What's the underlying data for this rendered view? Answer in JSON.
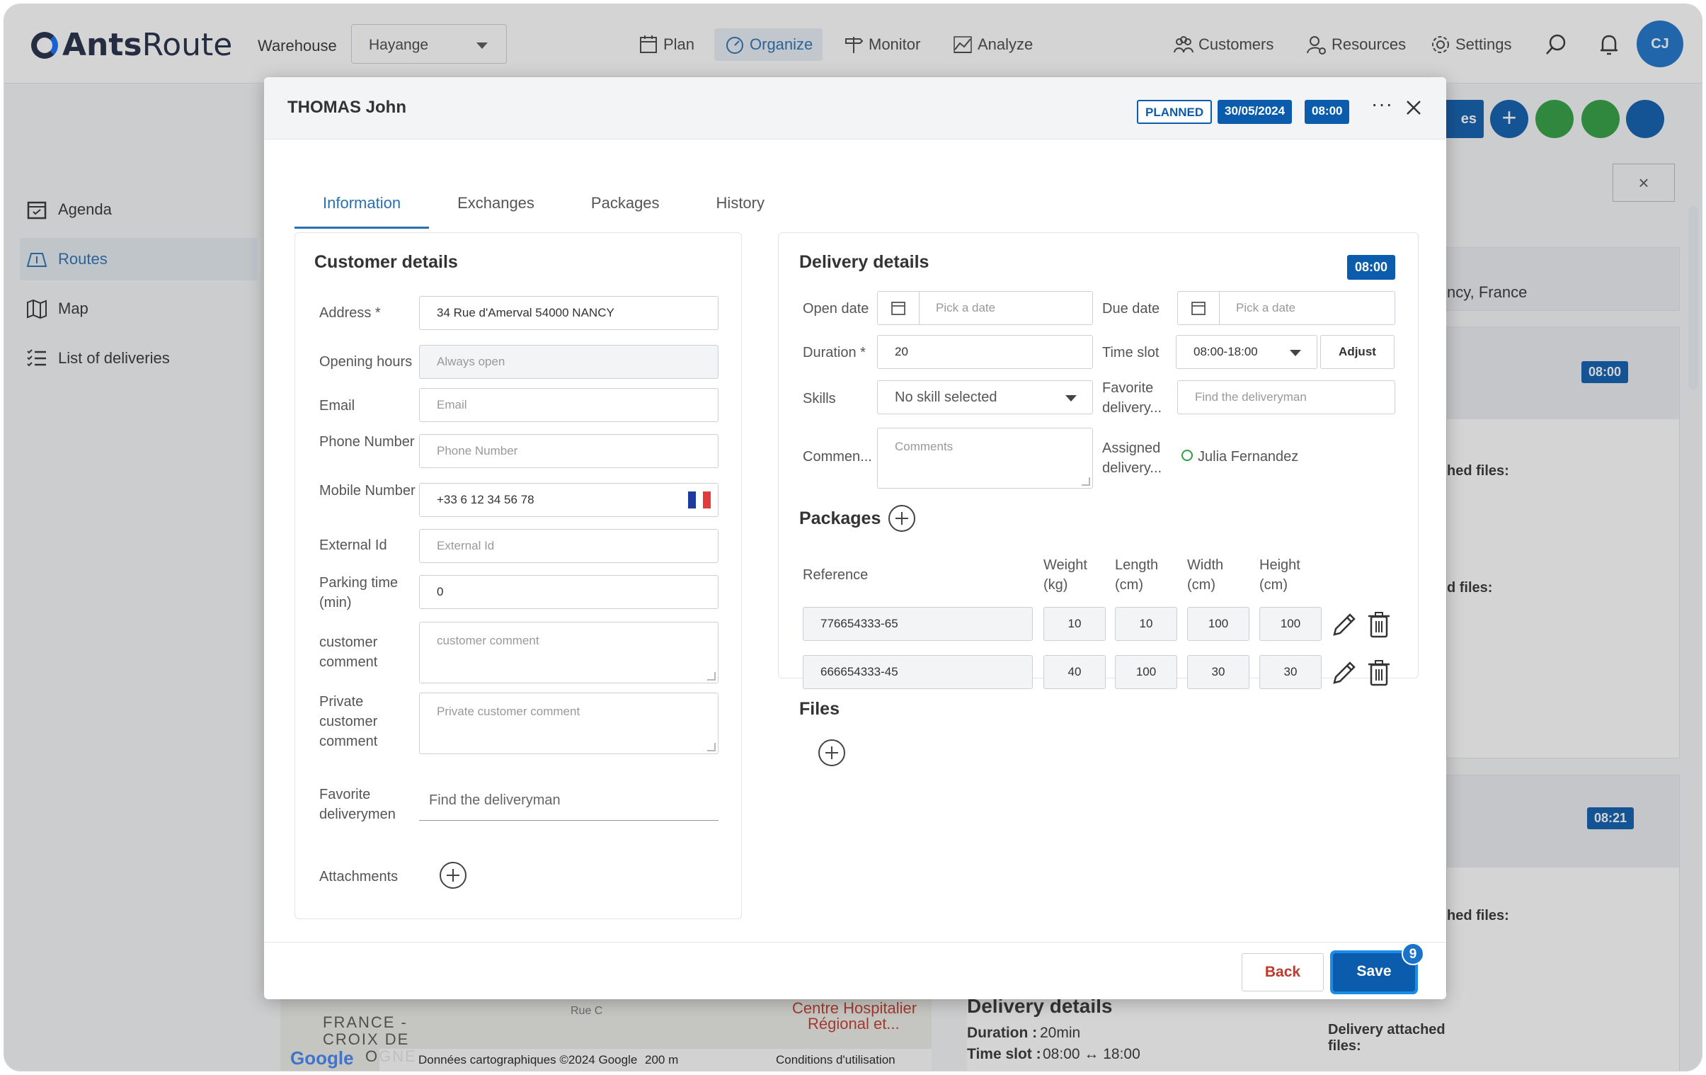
{
  "app": {
    "logo_bold": "Ants",
    "logo_light": "Route",
    "warehouse_label": "Warehouse",
    "warehouse_value": "Hayange",
    "nav": [
      "Plan",
      "Organize",
      "Monitor",
      "Analyze"
    ],
    "right_nav": [
      "Customers",
      "Resources",
      "Settings"
    ],
    "avatar": "CJ"
  },
  "sidebar": {
    "items": [
      {
        "label": "Agenda",
        "icon": "calendar-icon"
      },
      {
        "label": "Routes",
        "icon": "map-route-icon"
      },
      {
        "label": "Map",
        "icon": "map-icon"
      },
      {
        "label": "List of deliveries",
        "icon": "list-icon"
      }
    ]
  },
  "background": {
    "partial_button": "es",
    "address_fragment": "ncy, France",
    "time_badges": [
      "08:00",
      "08:21"
    ],
    "attached_files_frag": [
      "hed files:",
      "d files:",
      "hed files:"
    ],
    "delivery_details_title": "Delivery details",
    "duration_label": "Duration :",
    "duration_value": "20min",
    "timeslot_label": "Time slot :",
    "timeslot_value": "08:00 ↔ 18:00",
    "delivery_attached_files": "Delivery attached files:",
    "map_attribution": "Données cartographiques ©2024 Google",
    "map_scale": "200 m",
    "map_terms": "Conditions d'utilisation",
    "map_labels": [
      "FRANCE -",
      "CROIX DE",
      "OGNE",
      "Centre Hospitalier",
      "Régional et...",
      "Rue C"
    ],
    "google": "Google"
  },
  "modal": {
    "title": "THOMAS John",
    "status": "PLANNED",
    "date": "30/05/2024",
    "time": "08:00",
    "tabs": [
      "Information",
      "Exchanges",
      "Packages",
      "History"
    ],
    "customer": {
      "title": "Customer details",
      "address_label": "Address *",
      "address_value": "34 Rue d'Amerval 54000 NANCY",
      "opening_label": "Opening hours",
      "opening_value": "Always open",
      "email_label": "Email",
      "email_ph": "Email",
      "phone_label": "Phone Number",
      "phone_ph": "Phone Number",
      "mobile_label": "Mobile Number",
      "mobile_value": "+33 6 12 34 56 78",
      "external_label": "External Id",
      "external_ph": "External Id",
      "parking_label": "Parking time (min)",
      "parking_value": "0",
      "comment_label": "customer comment",
      "comment_ph": "customer comment",
      "private_label": "Private customer comment",
      "private_ph": "Private customer comment",
      "fav_label": "Favorite deliverymen",
      "fav_ph": "Find the deliveryman",
      "attach_label": "Attachments"
    },
    "delivery": {
      "title": "Delivery details",
      "badge": "08:00",
      "open_label": "Open date",
      "open_ph": "Pick a date",
      "due_label": "Due date",
      "due_ph": "Pick a date",
      "duration_label": "Duration *",
      "duration_value": "20",
      "timeslot_label": "Time slot",
      "timeslot_value": "08:00-18:00",
      "adjust": "Adjust",
      "skills_label": "Skills",
      "skills_value": "No skill selected",
      "favorite_label": "Favorite delivery...",
      "favorite_ph": "Find the deliveryman",
      "comment_label": "Commen...",
      "comment_ph": "Comments",
      "assigned_label": "Assigned delivery...",
      "assigned_value": "Julia Fernandez",
      "packages_title": "Packages",
      "headers": [
        "Reference",
        "Weight (kg)",
        "Length (cm)",
        "Width (cm)",
        "Height (cm)"
      ],
      "packages": [
        {
          "ref": "776654333-65",
          "weight": "10",
          "length": "10",
          "width": "100",
          "height": "100"
        },
        {
          "ref": "666654333-45",
          "weight": "40",
          "length": "100",
          "width": "30",
          "height": "30"
        }
      ],
      "files_title": "Files"
    },
    "back": "Back",
    "save": "Save",
    "save_badge": "9"
  },
  "colors": {
    "brand": "#0b5cad",
    "accent": "#1a73c9"
  }
}
